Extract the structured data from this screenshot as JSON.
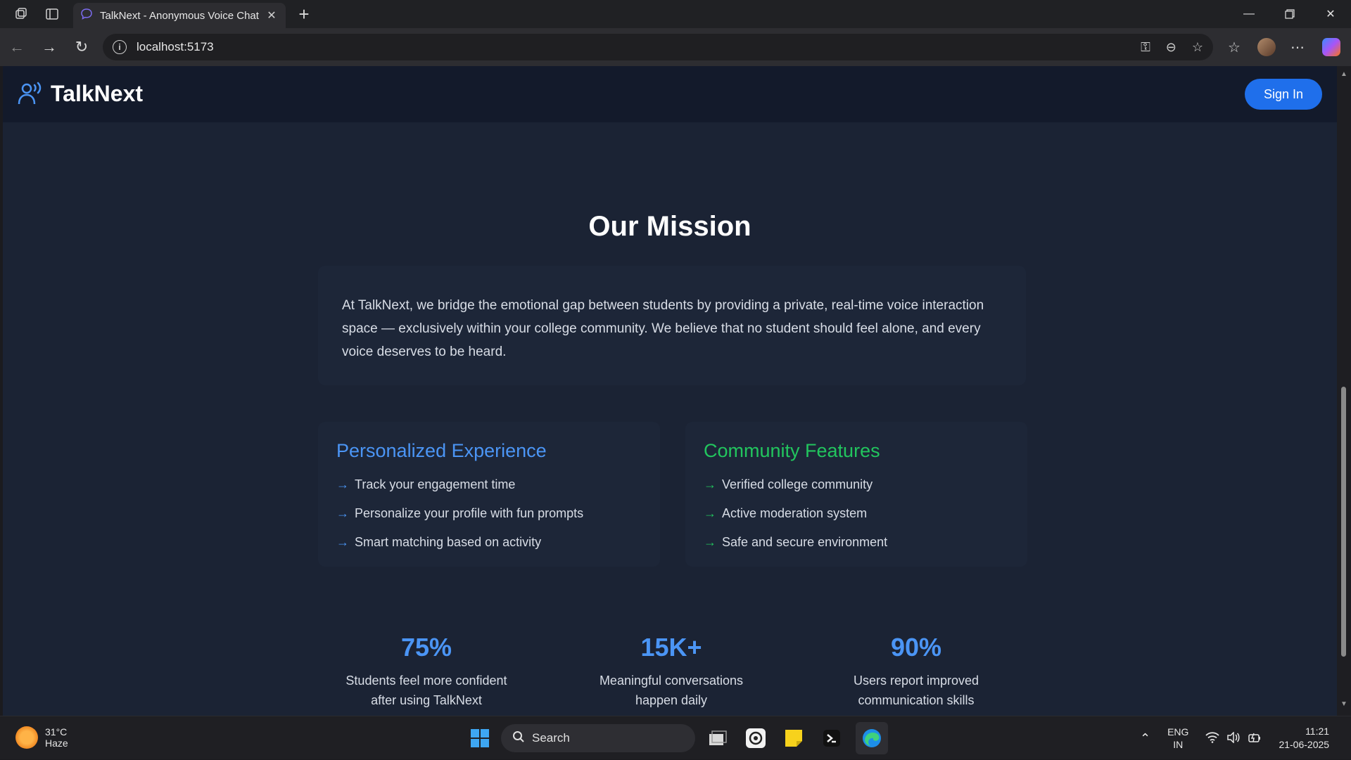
{
  "browser": {
    "tab_title": "TalkNext - Anonymous Voice Chat",
    "url": "localhost:5173"
  },
  "site": {
    "logo_text": "TalkNext",
    "signin_label": "Sign In"
  },
  "mission": {
    "title": "Our Mission",
    "text": "At TalkNext, we bridge the emotional gap between students by providing a private, real-time voice interaction space — exclusively within your college community. We believe that no student should feel alone, and every voice deserves to be heard."
  },
  "features": [
    {
      "title": "Personalized Experience",
      "color": "#4b95f5",
      "items": [
        "Track your engagement time",
        "Personalize your profile with fun prompts",
        "Smart matching based on activity"
      ]
    },
    {
      "title": "Community Features",
      "color": "#22c55e",
      "items": [
        "Verified college community",
        "Active moderation system",
        "Safe and secure environment"
      ]
    }
  ],
  "arrow": "→",
  "stats": [
    {
      "num": "75%",
      "line1": "Students feel more confident",
      "line2": "after using TalkNext"
    },
    {
      "num": "15K+",
      "line1": "Meaningful conversations",
      "line2": "happen daily"
    },
    {
      "num": "90%",
      "line1": "Users report improved",
      "line2": "communication skills"
    }
  ],
  "taskbar": {
    "temp": "31°C",
    "condition": "Haze",
    "search_label": "Search",
    "lang1": "ENG",
    "lang2": "IN",
    "time": "11:21",
    "date": "21-06-2025"
  }
}
